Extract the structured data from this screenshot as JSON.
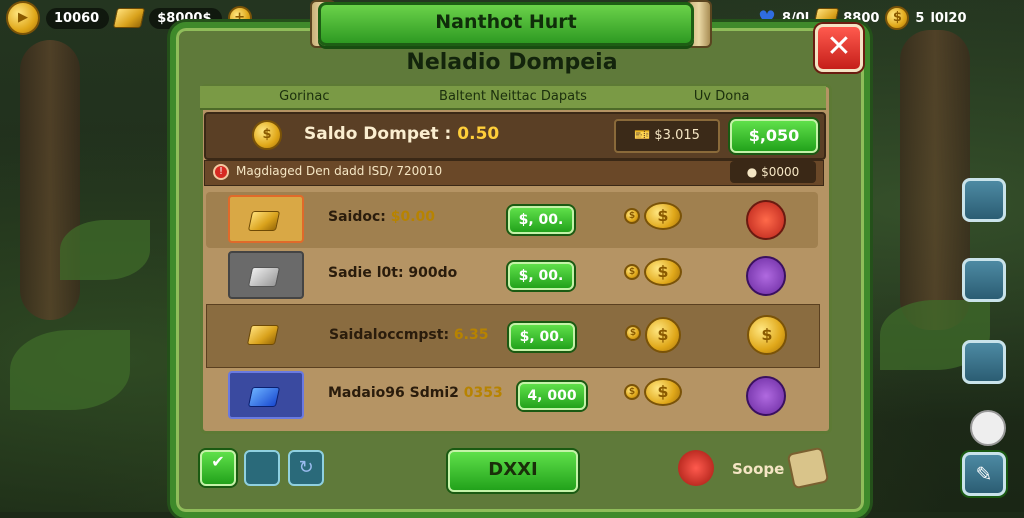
{
  "hud": {
    "coins_left": "10060",
    "gold_value": "$8000$",
    "gems_value": "8/0l",
    "gold_right": "8800",
    "right_count": "5",
    "right_total": "l0l20"
  },
  "window": {
    "banner_title": "Nanthot Hurt",
    "title": "Neladio Dompeia",
    "close_icon": "✕"
  },
  "tabs": [
    "Gorinac",
    "Baltent Neittac Dapats",
    "Uv Dona"
  ],
  "wallet": {
    "label": "Saldo Dompet :",
    "value": "0.50",
    "price": "$3.015",
    "buy_label": "$,050"
  },
  "notice": {
    "text": "Magdiaged Den dadd ISD/ 720010",
    "right_value": "$0000"
  },
  "items": [
    {
      "label": "Saidoc:",
      "value": "$0.00",
      "button": "$, 00.",
      "icon": "gold-bar-icon",
      "reward_icon": "red-arrow-icon"
    },
    {
      "label": "Sadie l0t: 900do",
      "value": "",
      "button": "$, 00.",
      "icon": "silver-bar-icon",
      "reward_icon": "purple-bowl-icon"
    },
    {
      "label": "Saidaloccmpst:",
      "value": "6.35",
      "button": "$, 00.",
      "icon": "gold-bar-icon",
      "reward_icon": "gold-coin-icon"
    },
    {
      "label": "Madaio96 Sdmi2",
      "value": "0353",
      "button": "4, 000",
      "icon": "blue-bar-icon",
      "reward_icon": "purple-bowl-icon"
    }
  ],
  "footer": {
    "main_button": "DXXI",
    "right_label": "Soope"
  },
  "colors": {
    "frame_green": "#3f8a2b",
    "button_green": "#22a21b",
    "close_red": "#c51f1a",
    "gold": "#e0a81a"
  }
}
